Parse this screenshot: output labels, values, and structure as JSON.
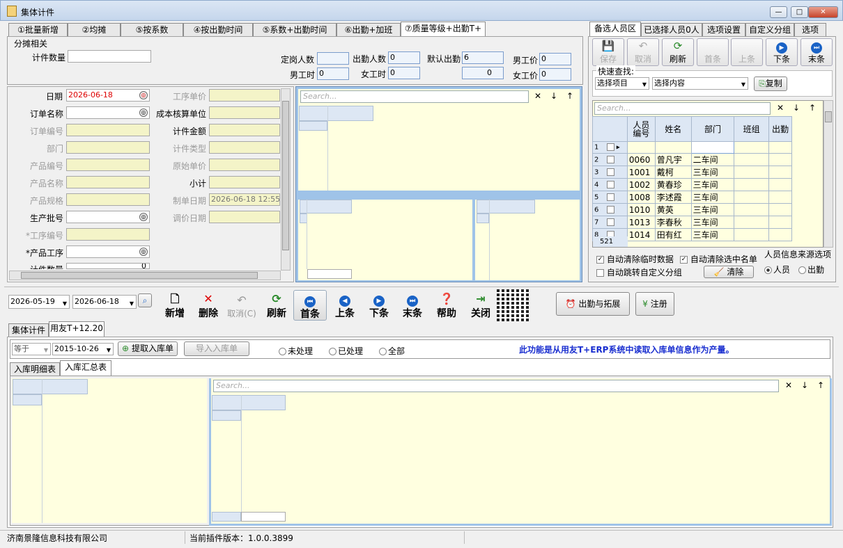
{
  "window": {
    "title": "集体计件",
    "min": "—",
    "max": "□",
    "close": "✕"
  },
  "main_tabs": [
    "①批量新增",
    "②均摊",
    "⑤按系数",
    "④按出勤时间",
    "⑤系数+出勤时间",
    "⑥出勤+加班",
    "⑦质量等级+出勤T+"
  ],
  "alloc": {
    "section": "分摊相关",
    "piece_qty_label": "计件数量",
    "piece_qty": "",
    "fixed_people_label": "定岗人数",
    "fixed_people": "",
    "attend_people_label": "出勤人数",
    "attend_people": "0",
    "default_attend_label": "默认出勤",
    "default_attend": "6",
    "male_price_label": "男工价",
    "male_price": "0",
    "male_hours_label": "男工时",
    "male_hours": "0",
    "female_hours_label": "女工时",
    "female_hours": "0",
    "female_price_label": "女工价",
    "female_price": "0",
    "dropdown_value": "0"
  },
  "form": {
    "date_label": "日期",
    "date": "2026-06-18",
    "order_name_label": "订单名称",
    "order_no_label": "订单编号",
    "dept_label": "部门",
    "product_no_label": "产品编号",
    "product_name_label": "产品名称",
    "product_spec_label": "产品规格",
    "batch_label": "生产批号",
    "process_no_label": "*工序编号",
    "product_process_label": "*产品工序",
    "piece_qty_label": "计件数量",
    "piece_qty": "0",
    "process_price_label": "工序单价",
    "cost_unit_label": "成本核算单位",
    "piece_amount_label": "计件金额",
    "piece_type_label": "计件类型",
    "orig_price_label": "原始单价",
    "subtotal_label": "小计",
    "made_date_label": "制单日期",
    "made_date": "2026-06-18 12:55:",
    "adjust_date_label": "调价日期"
  },
  "search": {
    "placeholder": "Search..."
  },
  "right_tabs": [
    "备选人员区",
    "已选择人员0人",
    "选项设置",
    "自定义分组",
    "选项"
  ],
  "right_toolbar": [
    "保存",
    "取消",
    "刷新",
    "首条",
    "上条",
    "下条",
    "末条"
  ],
  "quick": {
    "label": "快速查找:",
    "select_item": "选择项目",
    "select_content": "选择内容",
    "copy": "复制"
  },
  "people": {
    "headers": [
      "人员编号",
      "姓名",
      "部门",
      "班组",
      "出勤"
    ],
    "rows": [
      {
        "n": "1",
        "id": "",
        "name": "",
        "dept": ""
      },
      {
        "n": "2",
        "id": "0060",
        "name": "曾凡宇",
        "dept": "二车间"
      },
      {
        "n": "3",
        "id": "1001",
        "name": "戴柯",
        "dept": "三车间"
      },
      {
        "n": "4",
        "id": "1002",
        "name": "黄春珍",
        "dept": "三车间"
      },
      {
        "n": "5",
        "id": "1008",
        "name": "李述霞",
        "dept": "三车间"
      },
      {
        "n": "6",
        "id": "1010",
        "name": "黄英",
        "dept": "三车间"
      },
      {
        "n": "7",
        "id": "1013",
        "name": "李春秋",
        "dept": "三车间"
      },
      {
        "n": "8",
        "id": "1014",
        "name": "田有红",
        "dept": "三车间"
      }
    ],
    "count": "521"
  },
  "options": {
    "auto_clear_temp": "自动清除临时数据",
    "auto_clear_selected": "自动清除选中名单",
    "auto_jump_group": "自动跳转自定义分组",
    "clear": "清除",
    "source_label": "人员信息来源选项",
    "src_person": "人员",
    "src_attend": "出勤"
  },
  "bottom": {
    "date_from": "2026-05-19",
    "date_to": "2026-06-18",
    "tools": [
      "新增",
      "删除",
      "取消(C)",
      "刷新",
      "首条",
      "上条",
      "下条",
      "末条",
      "帮助",
      "关闭"
    ],
    "attend_ext": "出勤与拓展",
    "register": "注册"
  },
  "lower_tabs": [
    "集体计件",
    "用友T+12.20"
  ],
  "import": {
    "cond": "等于",
    "date": "2015-10-26",
    "fetch": "提取入库单",
    "import": "导入入库单",
    "r1": "未处理",
    "r2": "已处理",
    "r3": "全部",
    "note": "此功能是从用友T+ERP系统中读取入库单信息作为产量。"
  },
  "sub_tabs": [
    "入库明细表",
    "入库汇总表"
  ],
  "status": {
    "company": "济南景隆信息科技有限公司",
    "version": "当前插件版本：1.0.0.3899"
  },
  "colors": {
    "grid": "#ffffe0",
    "field_yellow": "#f4f4c8",
    "note_blue": "#1a2fd0"
  }
}
